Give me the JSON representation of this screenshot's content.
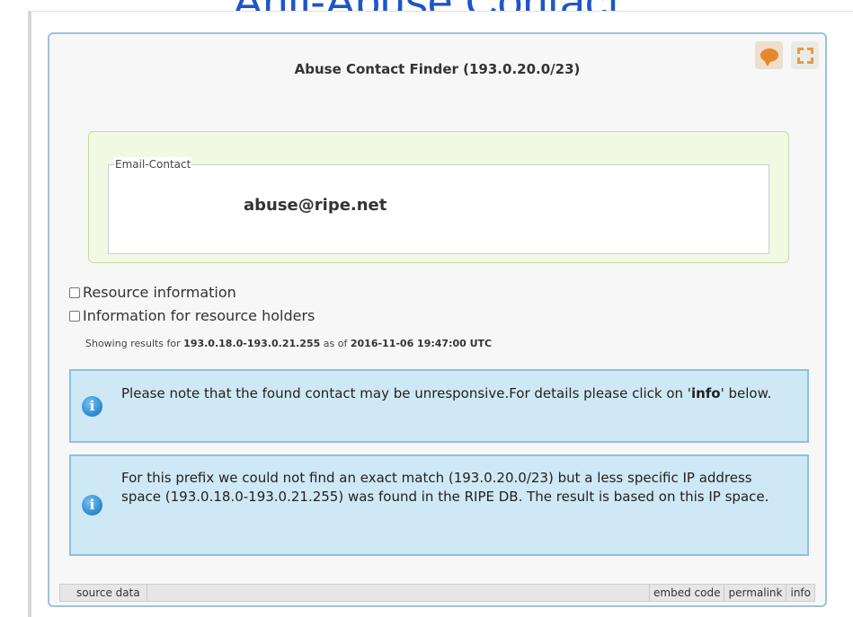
{
  "slide_title": "Anti-Abuse Contact",
  "widget": {
    "title": "Abuse Contact Finder (193.0.20.0/23)",
    "icons": {
      "chat": "speech-bubble-icon",
      "expand": "expand-icon"
    }
  },
  "contact": {
    "legend": "Email-Contact",
    "email": "abuse@ripe.net"
  },
  "checkboxes": [
    {
      "label": "Resource information",
      "checked": false
    },
    {
      "label": "Information for resource holders",
      "checked": false
    }
  ],
  "results": {
    "prefix": "Showing results for ",
    "range": "193.0.18.0-193.0.21.255",
    "middle": " as of ",
    "timestamp": "2016-11-06 19:47:00 UTC"
  },
  "notes": [
    {
      "before": "Please note that the found contact may be unresponsive.For details please click on '",
      "bold": "info",
      "after": "' below."
    },
    {
      "text": "For this prefix we could not find an exact match (193.0.20.0/23) but a less specific IP address space (193.0.18.0-193.0.21.255) was found in the RIPE DB. The result is based on this IP space."
    }
  ],
  "footer": {
    "source_data": "source data",
    "embed_code": "embed code",
    "permalink": "permalink",
    "info": "info"
  },
  "colors": {
    "title_blue": "#1f56c6",
    "widget_border": "#9fc2dc",
    "contact_panel_bg": "#f1f9e2",
    "note_bg": "#cfe8f5",
    "accent_orange": "#e8862a"
  }
}
